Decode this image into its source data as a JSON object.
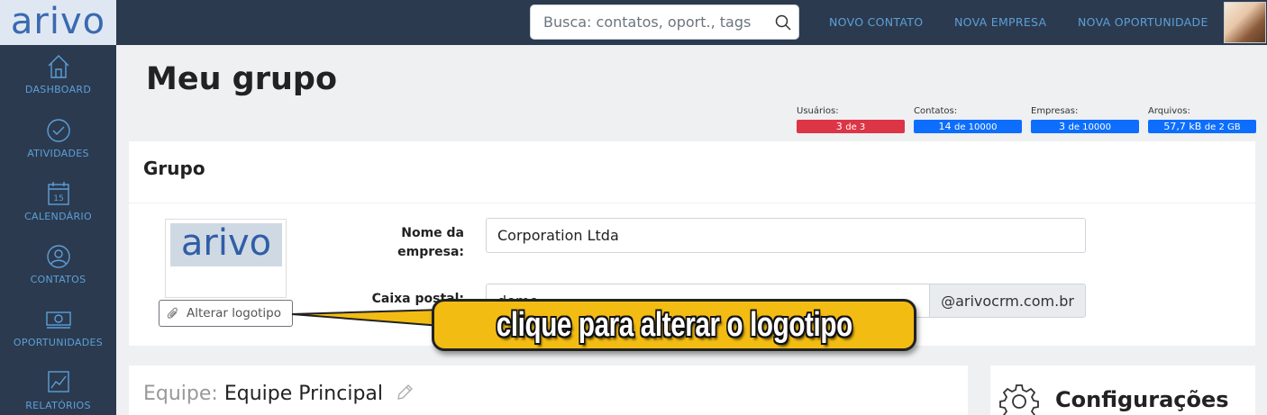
{
  "app": {
    "logo": "arivo"
  },
  "sidebar": {
    "items": [
      {
        "label": "DASHBOARD",
        "icon": "home-icon"
      },
      {
        "label": "ATIVIDADES",
        "icon": "check-circle-icon"
      },
      {
        "label": "CALENDÁRIO",
        "icon": "calendar-icon",
        "day": "15"
      },
      {
        "label": "CONTATOS",
        "icon": "person-icon"
      },
      {
        "label": "OPORTUNIDADES",
        "icon": "money-icon"
      },
      {
        "label": "RELATÓRIOS",
        "icon": "chart-icon"
      }
    ]
  },
  "topbar": {
    "search_placeholder": "Busca: contatos, oport., tags",
    "links": [
      "NOVO CONTATO",
      "NOVA EMPRESA",
      "NOVA OPORTUNIDADE"
    ]
  },
  "page": {
    "title": "Meu grupo"
  },
  "stats": [
    {
      "label": "Usuários:",
      "value": "3",
      "of": "de 3",
      "color": "#dc3545"
    },
    {
      "label": "Contatos:",
      "value": "14",
      "of": "de 10000",
      "color": "#0d6efd"
    },
    {
      "label": "Empresas:",
      "value": "3",
      "of": "de 10000",
      "color": "#0d6efd"
    },
    {
      "label": "Arquivos:",
      "value": "57,7 kB",
      "of": "de 2 GB",
      "color": "#0d6efd"
    }
  ],
  "grupo": {
    "title": "Grupo",
    "logo_text": "arivo",
    "change_logo_button": "Alterar logotipo",
    "company_name_label": "Nome da empresa:",
    "company_name_value": "Corporation Ltda",
    "mailbox_label": "Caixa postal:",
    "mailbox_value": "demo",
    "mailbox_domain": "@arivocrm.com.br"
  },
  "equipe": {
    "prefix": "Equipe:",
    "name": "Equipe Principal"
  },
  "config": {
    "title": "Configurações"
  },
  "callout": {
    "text": "clique para alterar o logotipo",
    "color": "#f3bc13"
  }
}
